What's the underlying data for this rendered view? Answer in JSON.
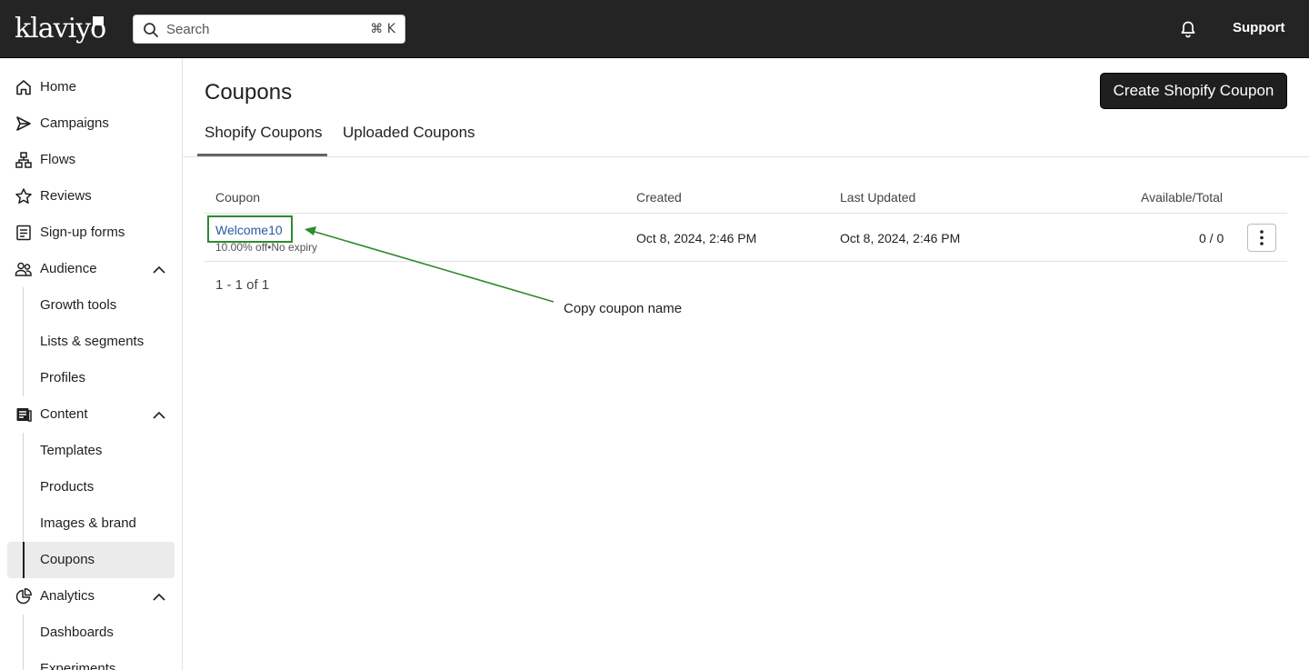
{
  "app": {
    "logo": "klaviyo"
  },
  "topbar": {
    "search_placeholder": "Search",
    "search_shortcut": "⌘ K",
    "support_label": "Support"
  },
  "sidebar": {
    "items": [
      {
        "label": "Home",
        "icon": "home-icon"
      },
      {
        "label": "Campaigns",
        "icon": "send-icon"
      },
      {
        "label": "Flows",
        "icon": "flows-icon"
      },
      {
        "label": "Reviews",
        "icon": "star-icon"
      },
      {
        "label": "Sign-up forms",
        "icon": "form-icon"
      },
      {
        "label": "Audience",
        "icon": "audience-icon",
        "expanded": true
      },
      {
        "label": "Growth tools"
      },
      {
        "label": "Lists & segments"
      },
      {
        "label": "Profiles"
      },
      {
        "label": "Content",
        "icon": "content-icon",
        "expanded": true
      },
      {
        "label": "Templates"
      },
      {
        "label": "Products"
      },
      {
        "label": "Images & brand"
      },
      {
        "label": "Coupons",
        "active": true
      },
      {
        "label": "Analytics",
        "icon": "analytics-icon",
        "expanded": true
      },
      {
        "label": "Dashboards"
      },
      {
        "label": "Experiments"
      }
    ]
  },
  "main": {
    "title": "Coupons",
    "create_button": "Create Shopify Coupon",
    "tabs": [
      {
        "label": "Shopify Coupons",
        "active": true
      },
      {
        "label": "Uploaded Coupons",
        "active": false
      }
    ],
    "table": {
      "headers": {
        "coupon": "Coupon",
        "created": "Created",
        "updated": "Last Updated",
        "available": "Available/Total"
      },
      "rows": [
        {
          "name": "Welcome10",
          "details": "10.00% off•No expiry",
          "created": "Oct 8, 2024, 2:46 PM",
          "updated": "Oct 8, 2024, 2:46 PM",
          "available": "0 / 0"
        }
      ]
    },
    "pagination": "1 - 1 of 1",
    "annotation": "Copy coupon name"
  },
  "colors": {
    "topbar": "#242424",
    "annotation": "#2f8a2f",
    "link": "#2c5aa0"
  }
}
